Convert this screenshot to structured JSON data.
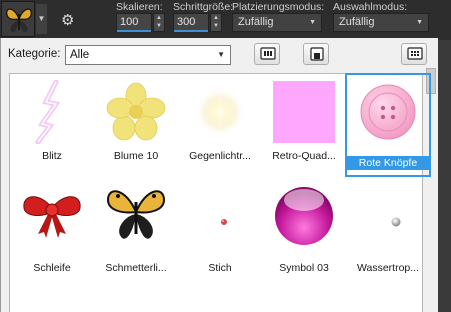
{
  "toolbar": {
    "scale_label": "Skalieren:",
    "scale_value": "100",
    "step_label": "Schrittgröße:",
    "step_value": "300",
    "placement_label": "Platzierungsmodus:",
    "placement_value": "Zufällig",
    "selection_label": "Auswahlmodus:",
    "selection_value": "Zufällig"
  },
  "panel": {
    "category_label": "Kategorie:",
    "category_value": "Alle"
  },
  "items": [
    {
      "label": "Blitz"
    },
    {
      "label": "Blume 10"
    },
    {
      "label": "Gegenlichtr..."
    },
    {
      "label": "Retro-Quad..."
    },
    {
      "label": "Rote Knöpfe",
      "selected": true
    },
    {
      "label": "Schleife"
    },
    {
      "label": "Schmetterli..."
    },
    {
      "label": "Stich"
    },
    {
      "label": "Symbol 03"
    },
    {
      "label": "Wassertrop..."
    }
  ],
  "colors": {
    "selection": "#3399e6",
    "panel_bg": "#f0f0f0",
    "toolbar_bg": "#2d2d2d"
  }
}
